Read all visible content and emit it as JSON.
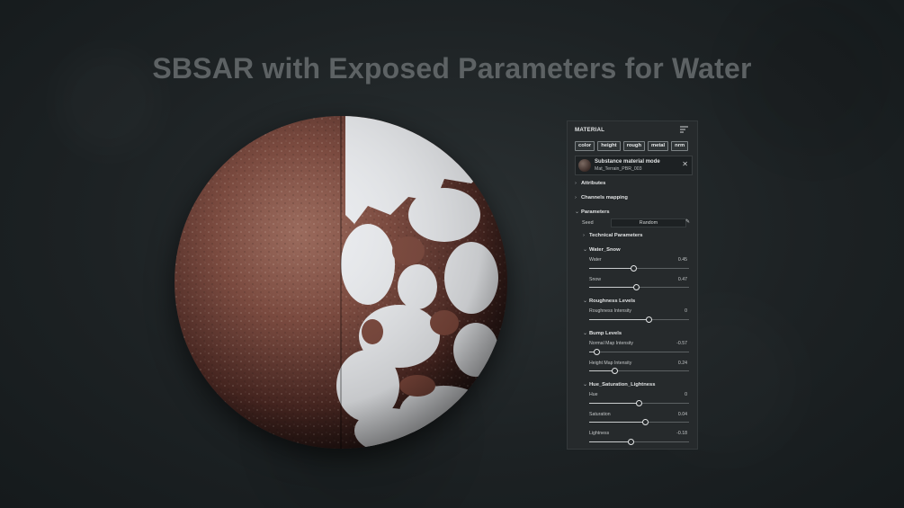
{
  "heading": "SBSAR with Exposed Parameters for Water",
  "panel": {
    "title": "MATERIAL",
    "menu_icon": "filter-list-icon",
    "chips": [
      "color",
      "height",
      "rough",
      "metal",
      "nrm"
    ],
    "material": {
      "name": "Substance material mode",
      "file": "Mat_Terrain_PBR_003",
      "close_icon": "close-icon"
    },
    "sections": {
      "attributes": "Attributes",
      "channels": "Channels mapping",
      "parameters": "Parameters"
    },
    "seed": {
      "label": "Seed",
      "value": "Random",
      "icon": "pencil-icon"
    },
    "technical": "Technical Parameters",
    "groups": [
      {
        "title": "Water_Snow",
        "params": [
          {
            "label": "Water",
            "value": "0.45",
            "fraction": 0.45
          },
          {
            "label": "Snow",
            "value": "0.47",
            "fraction": 0.47
          }
        ]
      },
      {
        "title": "Roughness Levels",
        "params": [
          {
            "label": "Roughness Intensity",
            "value": "0",
            "fraction": 0.6
          }
        ]
      },
      {
        "title": "Bump Levels",
        "params": [
          {
            "label": "Normal Map Intensity",
            "value": "-0.57",
            "fraction": 0.08
          },
          {
            "label": "Height Map Intensity",
            "value": "0.24",
            "fraction": 0.26
          }
        ]
      },
      {
        "title": "Hue_Saturation_Lightness",
        "params": [
          {
            "label": "Hue",
            "value": "0",
            "fraction": 0.5
          },
          {
            "label": "Saturation",
            "value": "0.04",
            "fraction": 0.56
          },
          {
            "label": "Lightness",
            "value": "-0.18",
            "fraction": 0.42
          }
        ]
      }
    ]
  }
}
